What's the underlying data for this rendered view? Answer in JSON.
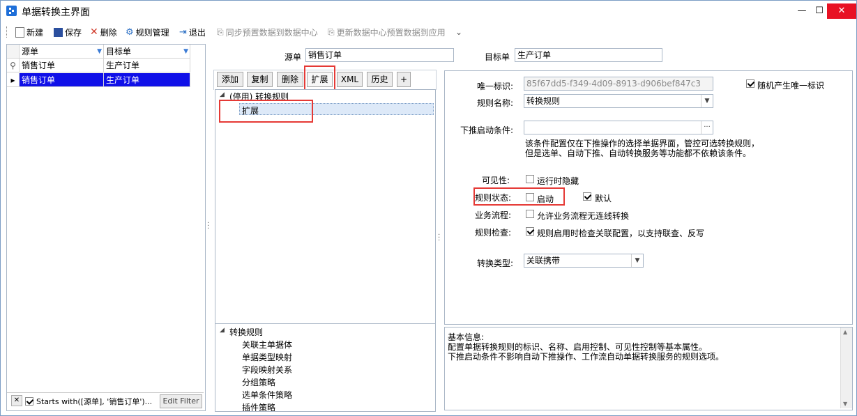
{
  "window": {
    "title": "单据转换主界面",
    "minimize": "—",
    "maximize": "☐",
    "close": "✕"
  },
  "toolbar": {
    "new": "新建",
    "save": "保存",
    "delete": "删除",
    "rule_manage": "规则管理",
    "exit": "退出",
    "sync_preset": "同步预置数据到数据中心",
    "update_preset": "更新数据中心预置数据到应用",
    "more": "⌄"
  },
  "grid": {
    "columns": [
      "源单",
      "目标单"
    ],
    "rows": [
      [
        "销售订单",
        "生产订单"
      ],
      [
        "销售订单",
        "生产订单"
      ]
    ],
    "row_markers": [
      "⚲",
      "▸"
    ],
    "filter_text": "Starts with([源单], '销售订单')...",
    "edit_filter": "Edit Filter",
    "filter_close": "✕"
  },
  "header": {
    "source_label": "源单",
    "source_value": "销售订单",
    "target_label": "目标单",
    "target_value": "生产订单"
  },
  "tabs": [
    "添加",
    "复制",
    "删除",
    "扩展",
    "XML",
    "历史",
    "+"
  ],
  "tree": {
    "root": "(停用) 转换规则",
    "child": "扩展"
  },
  "tree2": {
    "root": "转换规则",
    "items": [
      "关联主单据体",
      "单据类型映射",
      "字段映射关系",
      "分组策略",
      "选单条件策略",
      "插件策略"
    ]
  },
  "props": {
    "uid_label": "唯一标识:",
    "uid_value": "85f67dd5-f349-4d09-8913-d906bef847c3",
    "random_uid": "随机产生唯一标识",
    "rule_name_label": "规则名称:",
    "rule_name_value": "转换规则",
    "push_cond_label": "下推启动条件:",
    "push_cond_value": "",
    "push_cond_btn": "···",
    "push_note1": "该条件配置仅在下推操作的选择单据界面，管控可选转换规则，",
    "push_note2": "但是选单、自动下推、自动转换服务等功能都不依赖该条件。",
    "visible_label": "可见性:",
    "hide_runtime": "运行时隐藏",
    "status_label": "规则状态:",
    "enable": "启动",
    "default": "默认",
    "flow_label": "业务流程:",
    "allow_flow": "允许业务流程无连线转换",
    "check_label": "规则检查:",
    "check_text": "规则启用时检查关联配置，以支持联查、反写",
    "type_label": "转换类型:",
    "type_value": "关联携带"
  },
  "info": {
    "line1": "基本信息:",
    "line2": "配置单据转换规则的标识、名称、启用控制、可见性控制等基本属性。",
    "line3": "下推启动条件不影响自动下推操作、工作流自动单据转换服务的规则选项。"
  },
  "colors": {
    "accent": "#1010e8",
    "highlight": "#e53935",
    "border": "#a9b6c6"
  }
}
